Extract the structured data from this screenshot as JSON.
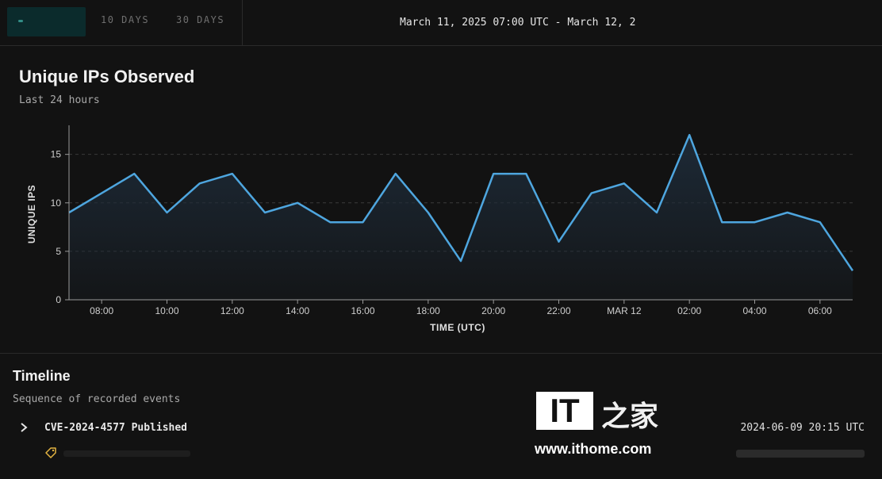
{
  "topbar": {
    "tabs": [
      {
        "label": ""
      },
      {
        "label": "10 DAYS"
      },
      {
        "label": "30 DAYS"
      }
    ],
    "date_range": "March 11, 2025 07:00 UTC - March 12, 2"
  },
  "chart": {
    "title": "Unique IPs Observed",
    "subtitle": "Last 24 hours"
  },
  "chart_data": {
    "type": "area",
    "xlabel": "TIME (UTC)",
    "ylabel": "UNIQUE IPS",
    "x": [
      "07:00",
      "08:00",
      "09:00",
      "10:00",
      "11:00",
      "12:00",
      "13:00",
      "14:00",
      "15:00",
      "16:00",
      "17:00",
      "18:00",
      "19:00",
      "20:00",
      "21:00",
      "22:00",
      "23:00",
      "00:00",
      "01:00",
      "02:00",
      "03:00",
      "04:00",
      "05:00",
      "06:00",
      "07:00"
    ],
    "y": [
      9,
      11,
      13,
      9,
      12,
      13,
      9,
      10,
      8,
      8,
      13,
      9,
      4,
      13,
      13,
      6,
      11,
      12,
      9,
      17,
      8,
      8,
      9,
      8,
      3
    ],
    "x_tick_labels": [
      "08:00",
      "10:00",
      "12:00",
      "14:00",
      "16:00",
      "18:00",
      "20:00",
      "22:00",
      "MAR 12",
      "02:00",
      "04:00",
      "06:00"
    ],
    "y_ticks": [
      "0",
      "5",
      "10",
      "15"
    ],
    "ylim": [
      0,
      18
    ],
    "grid": "horizontal-dashed",
    "line_color": "#4ea6df",
    "fill_color": "#1d2a37"
  },
  "timeline": {
    "title": "Timeline",
    "subtitle": "Sequence of recorded events",
    "events": [
      {
        "name": "CVE-2024-4577 Published",
        "time": "2024-06-09 20:15 UTC"
      }
    ]
  },
  "watermark": {
    "logo": "IT",
    "chinese": "之家",
    "url": "www.ithome.com"
  }
}
